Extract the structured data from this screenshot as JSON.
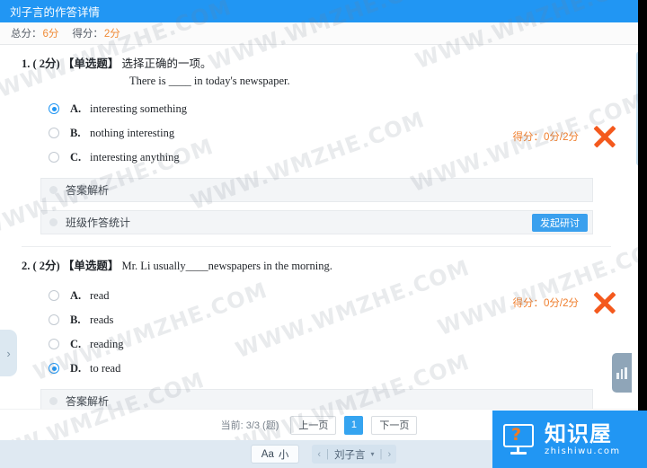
{
  "header": {
    "title": "刘子言的作答详情"
  },
  "score_bar": {
    "total_label": "总分：",
    "total_value": "6分",
    "earned_label": "得分：",
    "earned_value": "2分"
  },
  "questions": [
    {
      "number": "1.",
      "points": "( 2分)",
      "type": "【单选题】",
      "prompt": "选择正确的一项。",
      "subtext": "There is ____ in today's newspaper.",
      "options": [
        {
          "letter": "A.",
          "text": "interesting something",
          "selected": true
        },
        {
          "letter": "B.",
          "text": "nothing interesting",
          "selected": false
        },
        {
          "letter": "C.",
          "text": "interesting anything",
          "selected": false
        }
      ],
      "verdict": {
        "score_text": "得分：0分/2分",
        "mark": "cross-icon"
      },
      "panels": [
        {
          "label": "答案解析",
          "button": null
        },
        {
          "label": "班级作答统计",
          "button": "发起研讨"
        }
      ]
    },
    {
      "number": "2.",
      "points": "( 2分)",
      "type": "【单选题】",
      "prompt": "Mr. Li usually____newspapers in the morning.",
      "subtext": "",
      "options": [
        {
          "letter": "A.",
          "text": "read",
          "selected": false
        },
        {
          "letter": "B.",
          "text": "reads",
          "selected": false
        },
        {
          "letter": "C.",
          "text": "reading",
          "selected": false
        },
        {
          "letter": "D.",
          "text": "to read",
          "selected": true
        }
      ],
      "verdict": {
        "score_text": "得分：0分/2分",
        "mark": "cross-icon"
      },
      "panels": [
        {
          "label": "答案解析",
          "button": null
        }
      ]
    }
  ],
  "pagination": {
    "current_text": "当前: 3/3 (题)",
    "prev_label": "上一页",
    "page_number": "1",
    "next_label": "下一页"
  },
  "bottom_bar": {
    "font_icon": "Aa",
    "font_size_label": "小",
    "prev_arrow": "‹",
    "next_arrow": "›",
    "separator": "|",
    "student_name": "刘子言",
    "caret": "▾"
  },
  "edge_handles": {
    "left_arrow": "›",
    "right_icon": "bar-chart-icon"
  },
  "logo_watermark": {
    "cn": "知识屋",
    "en": "zhishiwu.com",
    "icon": "monitor-question-icon"
  },
  "page_watermark": {
    "text": "WWW.WMZHE.COM"
  },
  "colors": {
    "header_blue": "#2196f3",
    "accent_orange": "#f08a35",
    "cross_red": "#f4591d",
    "button_blue": "#3aa0ee",
    "page_active_blue": "#35a4f0"
  }
}
